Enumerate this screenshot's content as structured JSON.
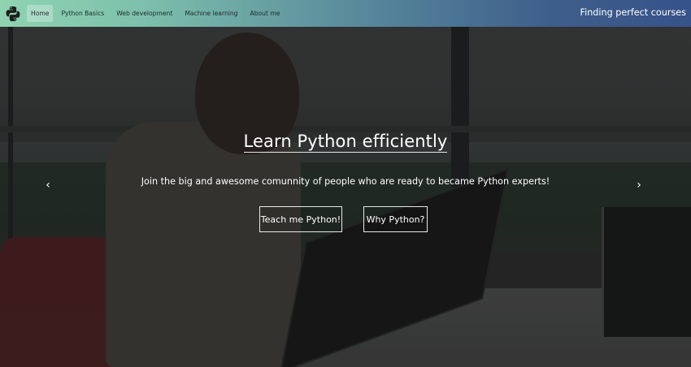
{
  "nav": {
    "logo_icon": "python-logo-icon",
    "items": [
      {
        "label": "Home",
        "active": true
      },
      {
        "label": "Python Basics",
        "active": false
      },
      {
        "label": "Web development",
        "active": false
      },
      {
        "label": "Machine learning",
        "active": false
      },
      {
        "label": "About me",
        "active": false
      }
    ],
    "tagline": "Finding perfect courses"
  },
  "hero": {
    "title": "Learn Python efficiently",
    "subtitle": "Join the big and awesome comunnity of people who are ready to became Python experts!",
    "primary_button": "Teach me Python!",
    "secondary_button": "Why Python?",
    "prev_icon": "chevron-left-icon",
    "next_icon": "chevron-right-icon"
  },
  "colors": {
    "nav_gradient_start": "#8fd3b2",
    "nav_gradient_end": "#36538a",
    "text_light": "#ffffff"
  }
}
